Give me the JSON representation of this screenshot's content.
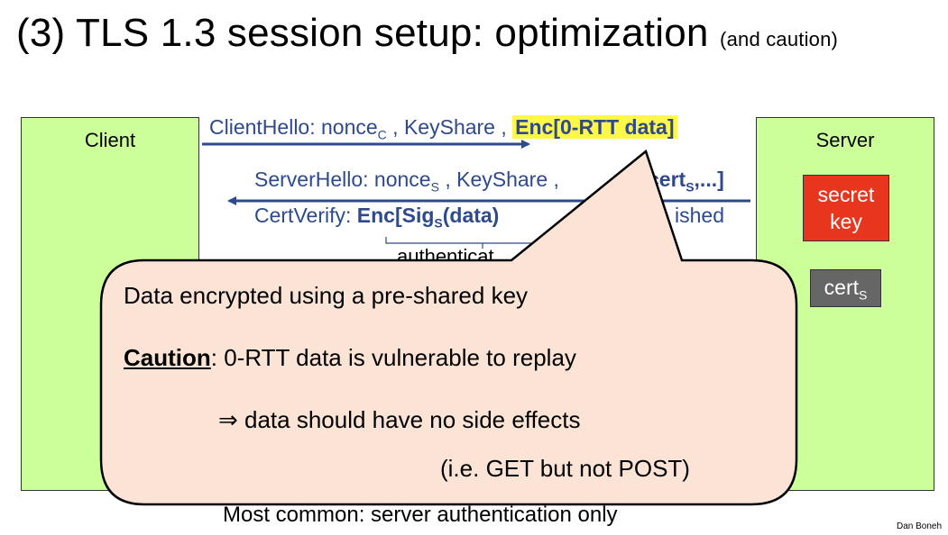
{
  "title": {
    "main": "(3)  TLS 1.3 session setup: optimization",
    "sub": "(and caution)"
  },
  "client": {
    "label": "Client"
  },
  "server": {
    "label": "Server",
    "secret_line1": "secret",
    "secret_line2": "key",
    "cert": "cert",
    "cert_sub": "S"
  },
  "messages": {
    "client_hello": {
      "prefix": "ClientHello: nonce",
      "sub": "C",
      "middle": " , KeyShare , ",
      "enc": "Enc[0-RTT data]"
    },
    "server_hello": {
      "prefix": "ServerHello: nonce",
      "sub": "S",
      "middle": " , KeyShare , ",
      "enc_end": "cert",
      "enc_sub": "S",
      "enc_tail": ",...]"
    },
    "cert_verify": {
      "prefix": "CertVerify:   ",
      "enc": "Enc[Sig",
      "enc_sub": "S",
      "enc_tail": "(data)",
      "finished": "ished"
    },
    "brace_label": "authenticat"
  },
  "callout": {
    "line1": "Data encrypted using a pre-shared key",
    "caution_label": "Caution",
    "caution_text": ":  0-RTT data is vulnerable to replay",
    "line3": "⇒  data should have no side effects",
    "line4": "(i.e. GET but not POST)"
  },
  "footer": {
    "bottom": "Most common:   server authentication only",
    "credit": "Dan Boneh"
  },
  "colors": {
    "box_green": "#ccff99",
    "secret_red": "#e8351e",
    "cert_gray": "#666666",
    "arrow_blue": "#2f4a8c",
    "highlight": "#fff84a",
    "callout_fill": "#fbe4d5"
  }
}
